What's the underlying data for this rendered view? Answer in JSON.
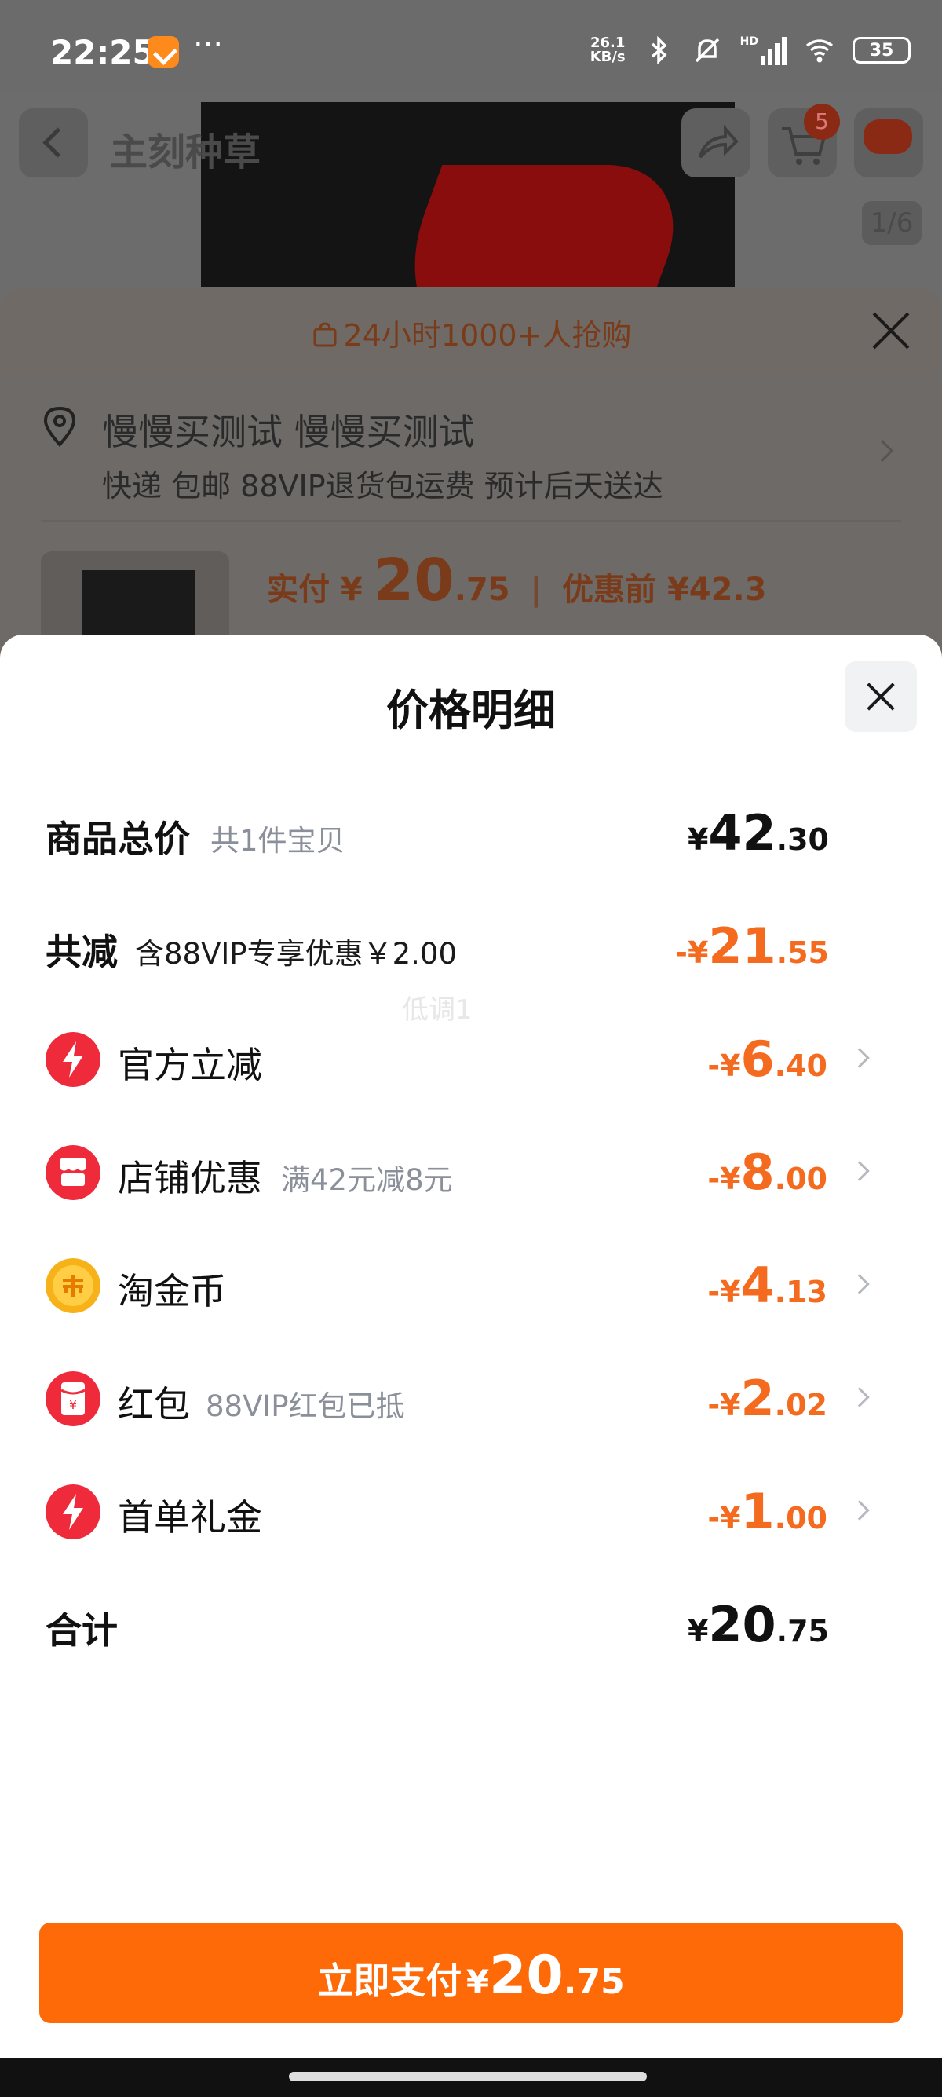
{
  "status_bar": {
    "time": "22:25",
    "overflow_dots": "···",
    "net_speed_top": "26.1",
    "net_speed_unit": "KB/s",
    "signal_label": "HD",
    "battery": "35"
  },
  "background_header": {
    "title": "主刻种草",
    "cart_count": "5",
    "image_counter": "1/6"
  },
  "order_sheet": {
    "promo": "24小时1000+人抢购",
    "address_name": "慢慢买测试 慢慢买测试",
    "address_sub": "快递 包邮 88VIP退货包运费 预计后天送达",
    "pay_prefix": "实付 ¥",
    "pay_int": "20",
    "pay_dec": ".75",
    "pay_before": "优惠前 ¥42.3"
  },
  "price_detail": {
    "title": "价格明细",
    "watermark": "低调1",
    "rows": [
      {
        "label": "商品总价",
        "sub": "共1件宝贝",
        "currency": "¥",
        "int": "42",
        "dec": ".30",
        "color": "#111111"
      },
      {
        "label": "共减",
        "sub": "含88VIP专享优惠￥2.00",
        "currency": "-¥",
        "int": "21",
        "dec": ".55",
        "color": "#f46a1e"
      },
      {
        "label": "官方立减",
        "sub": "",
        "icon": "lightning-icon",
        "currency": "-¥",
        "int": "6",
        "dec": ".40",
        "color": "#f46a1e"
      },
      {
        "label": "店铺优惠",
        "sub": "满42元减8元",
        "icon": "shop-icon",
        "currency": "-¥",
        "int": "8",
        "dec": ".00",
        "color": "#f46a1e"
      },
      {
        "label": "淘金币",
        "sub": "",
        "icon": "gold-coin-icon",
        "currency": "-¥",
        "int": "4",
        "dec": ".13",
        "color": "#f46a1e"
      },
      {
        "label": "红包",
        "sub": "88VIP红包已抵",
        "icon": "red-envelope-icon",
        "currency": "-¥",
        "int": "2",
        "dec": ".02",
        "color": "#f46a1e"
      },
      {
        "label": "首单礼金",
        "sub": "",
        "icon": "lightning-icon",
        "currency": "-¥",
        "int": "1",
        "dec": ".00",
        "color": "#f46a1e"
      }
    ],
    "total": {
      "label": "合计",
      "currency": "¥",
      "int": "20",
      "dec": ".75"
    }
  },
  "pay_button": {
    "label": "立即支付",
    "currency": "¥",
    "int": "20",
    "dec": ".75",
    "color": "#ff6a09"
  }
}
